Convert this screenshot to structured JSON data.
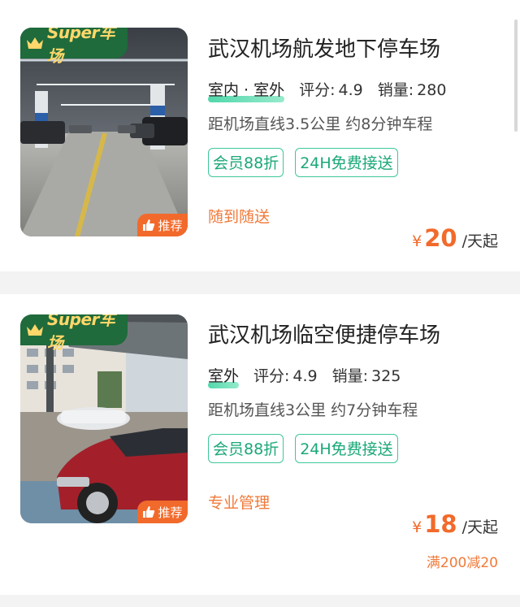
{
  "badge": {
    "brand_text": "Super车场",
    "recommend_text": "推荐"
  },
  "listings": [
    {
      "title": "武汉机场航发地下停车场",
      "location": "室内 · 室外",
      "rating_label": "评分:",
      "rating": "4.9",
      "sales_label": "销量:",
      "sales": "280",
      "distance": "距机场直线3.5公里 约8分钟车程",
      "tags": [
        "会员88折",
        "24H免费接送"
      ],
      "feature": "随到随送",
      "price_currency": "¥",
      "price": "20",
      "price_unit": "/天起"
    },
    {
      "title": "武汉机场临空便捷停车场",
      "location": "室外",
      "rating_label": "评分:",
      "rating": "4.9",
      "sales_label": "销量:",
      "sales": "325",
      "distance": "距机场直线3公里 约7分钟车程",
      "tags": [
        "会员88折",
        "24H免费接送"
      ],
      "feature": "专业管理",
      "price_currency": "¥",
      "price": "18",
      "price_unit": "/天起",
      "discount": "满200减20"
    }
  ],
  "colors": {
    "accent_green": "#1aa877",
    "brand_green": "#1f6b3b",
    "price_orange": "#f26a2b"
  }
}
